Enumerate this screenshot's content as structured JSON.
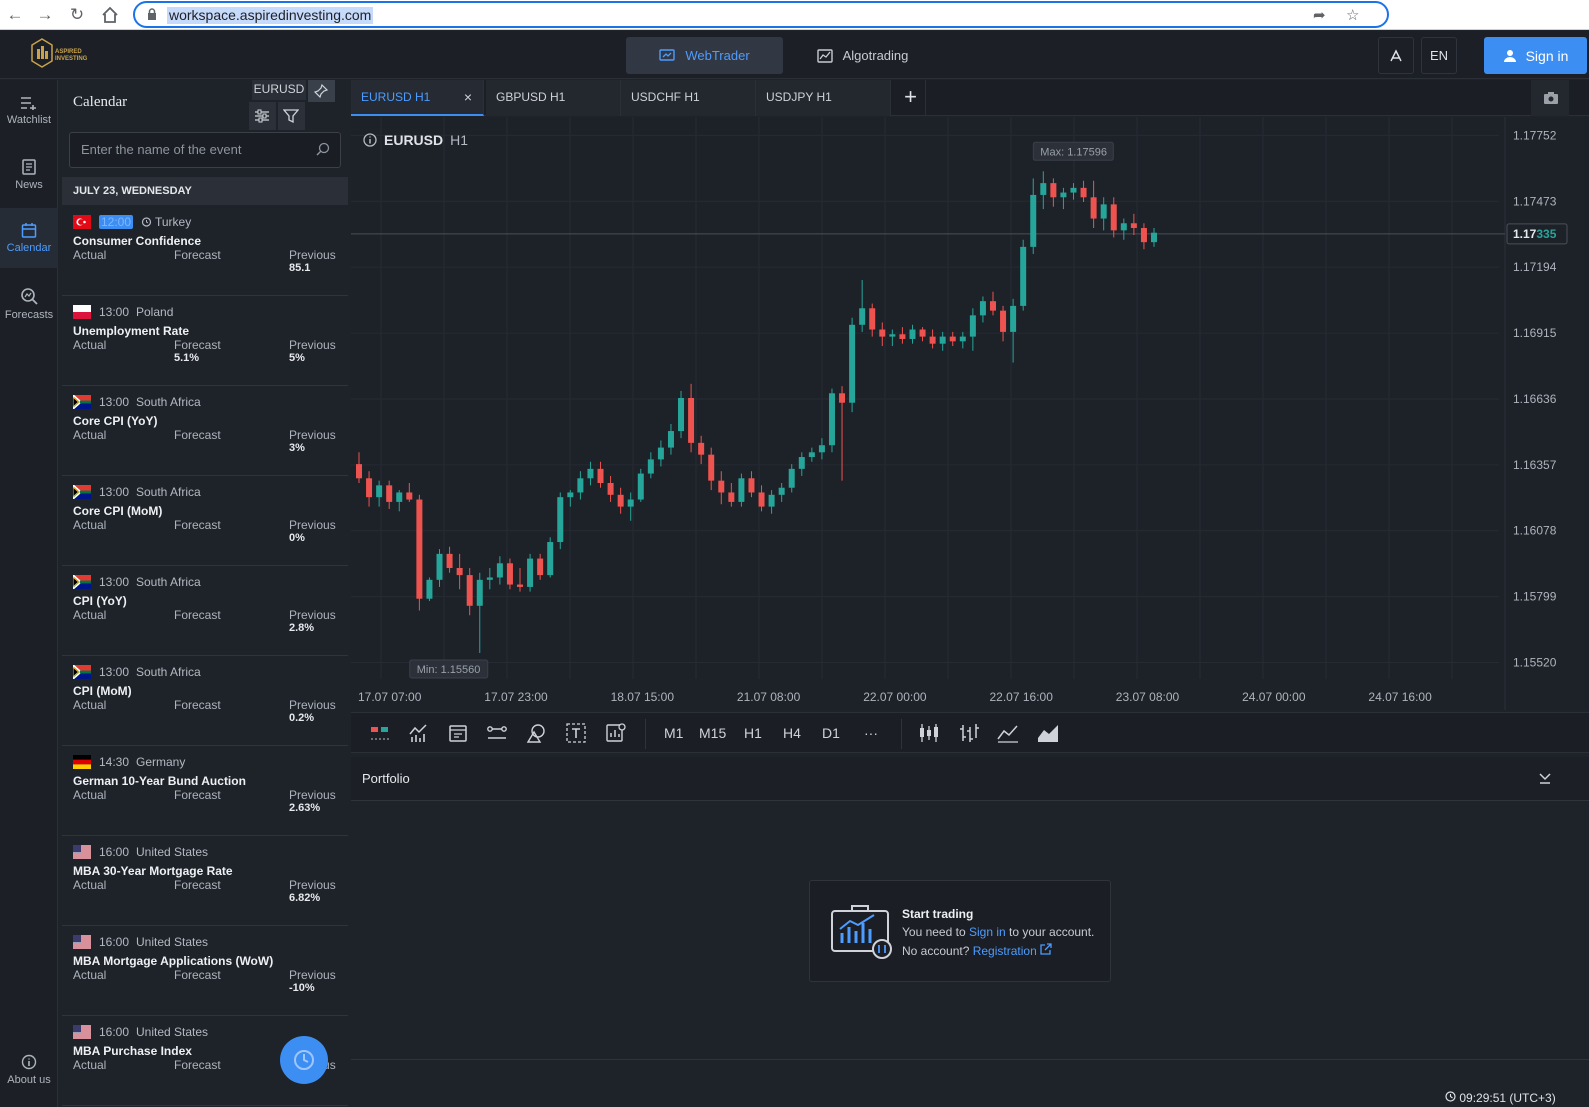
{
  "browser": {
    "url": "workspace.aspiredinvesting.com"
  },
  "header": {
    "logo_text": "ASPIRED INVESTING",
    "webtrader_label": "WebTrader",
    "algotrading_label": "Algotrading",
    "language": "EN",
    "signin_label": "Sign in"
  },
  "rail": {
    "items": [
      {
        "label": "Watchlist",
        "icon": "watchlist-icon"
      },
      {
        "label": "News",
        "icon": "news-icon"
      },
      {
        "label": "Calendar",
        "icon": "calendar-icon"
      },
      {
        "label": "Forecasts",
        "icon": "forecasts-icon"
      }
    ],
    "about_label": "About us"
  },
  "calendar": {
    "title": "Calendar",
    "symbol": "EURUSD",
    "search_placeholder": "Enter the name of the event",
    "date_header": "JULY 23, WEDNESDAY",
    "actual_label": "Actual",
    "forecast_label": "Forecast",
    "previous_label": "Previous",
    "events": [
      {
        "time": "12:00",
        "country": "Turkey",
        "flag": "tr",
        "name": "Consumer Confidence",
        "forecast": "",
        "previous": "85.1",
        "highlight": true
      },
      {
        "time": "13:00",
        "country": "Poland",
        "flag": "pl",
        "name": "Unemployment Rate",
        "forecast": "5.1%",
        "previous": "5%"
      },
      {
        "time": "13:00",
        "country": "South Africa",
        "flag": "za",
        "name": "Core CPI (YoY)",
        "forecast": "",
        "previous": "3%"
      },
      {
        "time": "13:00",
        "country": "South Africa",
        "flag": "za",
        "name": "Core CPI (MoM)",
        "forecast": "",
        "previous": "0%"
      },
      {
        "time": "13:00",
        "country": "South Africa",
        "flag": "za",
        "name": "CPI (YoY)",
        "forecast": "",
        "previous": "2.8%"
      },
      {
        "time": "13:00",
        "country": "South Africa",
        "flag": "za",
        "name": "CPI (MoM)",
        "forecast": "",
        "previous": "0.2%"
      },
      {
        "time": "14:30",
        "country": "Germany",
        "flag": "de",
        "name": "German 10-Year Bund Auction",
        "forecast": "",
        "previous": "2.63%"
      },
      {
        "time": "16:00",
        "country": "United States",
        "flag": "us",
        "name": "MBA 30-Year Mortgage Rate",
        "forecast": "",
        "previous": "6.82%"
      },
      {
        "time": "16:00",
        "country": "United States",
        "flag": "us",
        "name": "MBA Mortgage Applications (WoW)",
        "forecast": "",
        "previous": "-10%"
      },
      {
        "time": "16:00",
        "country": "United States",
        "flag": "us",
        "name": "MBA Purchase Index",
        "forecast": "",
        "previous": ""
      }
    ]
  },
  "tabs": [
    {
      "label": "EURUSD H1",
      "active": true
    },
    {
      "label": "GBPUSD H1"
    },
    {
      "label": "USDCHF H1"
    },
    {
      "label": "USDJPY H1"
    }
  ],
  "chart": {
    "symbol": "EURUSD",
    "timeframe": "H1",
    "max_label": "Max: 1.17596",
    "min_label": "Min: 1.15560",
    "current_price_main": "1.17",
    "current_price_tail": "335",
    "up_color": "#26a69a",
    "down_color": "#ef5350"
  },
  "chart_data": {
    "type": "candlestick",
    "y_ticks": [
      1.17752,
      1.17473,
      1.17194,
      1.16915,
      1.16636,
      1.16357,
      1.16078,
      1.15799,
      1.1552
    ],
    "ylim": [
      1.1545,
      1.1783
    ],
    "x_ticks": [
      "17.07 07:00",
      "17.07 23:00",
      "18.07 15:00",
      "21.07 08:00",
      "22.07 00:00",
      "22.07 16:00",
      "23.07 08:00",
      "24.07 00:00",
      "24.07 16:00"
    ],
    "current_price": 1.17335,
    "max": 1.17596,
    "min": 1.1556,
    "candles": [
      [
        1.1636,
        1.1641,
        1.1628,
        1.163
      ],
      [
        1.163,
        1.1633,
        1.1618,
        1.1622
      ],
      [
        1.1622,
        1.1629,
        1.1618,
        1.1627
      ],
      [
        1.1627,
        1.1629,
        1.1617,
        1.162
      ],
      [
        1.162,
        1.1625,
        1.1616,
        1.1624
      ],
      [
        1.1624,
        1.1628,
        1.162,
        1.1621
      ],
      [
        1.1621,
        1.1623,
        1.1574,
        1.1579
      ],
      [
        1.1579,
        1.1588,
        1.1578,
        1.1587
      ],
      [
        1.1587,
        1.16,
        1.1584,
        1.1598
      ],
      [
        1.1598,
        1.1601,
        1.159,
        1.1592
      ],
      [
        1.1592,
        1.1598,
        1.1583,
        1.1589
      ],
      [
        1.1589,
        1.1592,
        1.1572,
        1.1576
      ],
      [
        1.1576,
        1.159,
        1.1556,
        1.1587
      ],
      [
        1.1587,
        1.1592,
        1.1583,
        1.1588
      ],
      [
        1.1588,
        1.1597,
        1.1585,
        1.1594
      ],
      [
        1.1594,
        1.1596,
        1.1583,
        1.1585
      ],
      [
        1.1585,
        1.1592,
        1.1582,
        1.1584
      ],
      [
        1.1584,
        1.1598,
        1.1582,
        1.1596
      ],
      [
        1.1596,
        1.1598,
        1.1587,
        1.1589
      ],
      [
        1.1589,
        1.1605,
        1.1588,
        1.1603
      ],
      [
        1.1603,
        1.1624,
        1.16,
        1.1622
      ],
      [
        1.1622,
        1.1625,
        1.1618,
        1.1624
      ],
      [
        1.1624,
        1.1633,
        1.1621,
        1.163
      ],
      [
        1.163,
        1.1637,
        1.1627,
        1.1634
      ],
      [
        1.1634,
        1.1637,
        1.1626,
        1.1628
      ],
      [
        1.1628,
        1.1631,
        1.162,
        1.1623
      ],
      [
        1.1623,
        1.1626,
        1.1615,
        1.1618
      ],
      [
        1.1618,
        1.1624,
        1.1612,
        1.1621
      ],
      [
        1.1621,
        1.1634,
        1.162,
        1.1632
      ],
      [
        1.1632,
        1.1641,
        1.163,
        1.1638
      ],
      [
        1.1638,
        1.1646,
        1.1635,
        1.1643
      ],
      [
        1.1643,
        1.1653,
        1.164,
        1.165
      ],
      [
        1.165,
        1.1667,
        1.1647,
        1.1664
      ],
      [
        1.1664,
        1.167,
        1.1641,
        1.1645
      ],
      [
        1.1645,
        1.1648,
        1.1636,
        1.164
      ],
      [
        1.164,
        1.1643,
        1.1625,
        1.1629
      ],
      [
        1.1629,
        1.1633,
        1.1619,
        1.1624
      ],
      [
        1.1624,
        1.1628,
        1.1618,
        1.162
      ],
      [
        1.162,
        1.1632,
        1.1618,
        1.163
      ],
      [
        1.163,
        1.1633,
        1.1622,
        1.1624
      ],
      [
        1.1624,
        1.1627,
        1.1616,
        1.1618
      ],
      [
        1.1618,
        1.1625,
        1.1615,
        1.1623
      ],
      [
        1.1623,
        1.1628,
        1.162,
        1.1626
      ],
      [
        1.1626,
        1.1636,
        1.1624,
        1.1634
      ],
      [
        1.1634,
        1.1641,
        1.1631,
        1.1639
      ],
      [
        1.1639,
        1.1643,
        1.1637,
        1.1641
      ],
      [
        1.1641,
        1.1647,
        1.1638,
        1.1644
      ],
      [
        1.1644,
        1.1668,
        1.1641,
        1.1666
      ],
      [
        1.1666,
        1.1669,
        1.1629,
        1.1662
      ],
      [
        1.1662,
        1.1698,
        1.1658,
        1.1695
      ],
      [
        1.1695,
        1.1714,
        1.1692,
        1.1702
      ],
      [
        1.1702,
        1.1704,
        1.169,
        1.1693
      ],
      [
        1.1693,
        1.1696,
        1.1686,
        1.169
      ],
      [
        1.169,
        1.1693,
        1.1686,
        1.1691
      ],
      [
        1.1691,
        1.1694,
        1.1687,
        1.1689
      ],
      [
        1.1689,
        1.1695,
        1.1687,
        1.1693
      ],
      [
        1.1693,
        1.1694,
        1.1688,
        1.169
      ],
      [
        1.169,
        1.1693,
        1.1685,
        1.1687
      ],
      [
        1.1687,
        1.1692,
        1.1684,
        1.169
      ],
      [
        1.169,
        1.1692,
        1.1686,
        1.1688
      ],
      [
        1.1688,
        1.1692,
        1.1685,
        1.169
      ],
      [
        1.169,
        1.1702,
        1.1684,
        1.1699
      ],
      [
        1.1699,
        1.1707,
        1.1696,
        1.1705
      ],
      [
        1.1705,
        1.1709,
        1.1699,
        1.1701
      ],
      [
        1.1701,
        1.1703,
        1.1688,
        1.1692
      ],
      [
        1.1692,
        1.1706,
        1.1679,
        1.1703
      ],
      [
        1.1703,
        1.1731,
        1.1701,
        1.1728
      ],
      [
        1.1728,
        1.1757,
        1.1725,
        1.175
      ],
      [
        1.175,
        1.176,
        1.1744,
        1.1755
      ],
      [
        1.1755,
        1.1757,
        1.1745,
        1.1749
      ],
      [
        1.1749,
        1.1753,
        1.1744,
        1.1751
      ],
      [
        1.1751,
        1.1755,
        1.1748,
        1.1753
      ],
      [
        1.1753,
        1.1756,
        1.1747,
        1.1749
      ],
      [
        1.1749,
        1.1756,
        1.1736,
        1.174
      ],
      [
        1.174,
        1.1749,
        1.1735,
        1.1746
      ],
      [
        1.1746,
        1.1749,
        1.1732,
        1.1735
      ],
      [
        1.1735,
        1.174,
        1.1731,
        1.1738
      ],
      [
        1.1738,
        1.1742,
        1.1733,
        1.1736
      ],
      [
        1.1736,
        1.1738,
        1.1727,
        1.173
      ],
      [
        1.173,
        1.1736,
        1.1728,
        1.1734
      ]
    ]
  },
  "toolbar": {
    "timeframes": [
      "M1",
      "M15",
      "H1",
      "H4",
      "D1",
      "···"
    ]
  },
  "portfolio": {
    "title": "Portfolio",
    "start_title": "Start trading",
    "line1_pre": "You need to ",
    "line1_link": "Sign in",
    "line1_post": " to your account.",
    "line2_pre": "No account? ",
    "line2_link": "Registration"
  },
  "clock": "09:29:51 (UTC+3)"
}
